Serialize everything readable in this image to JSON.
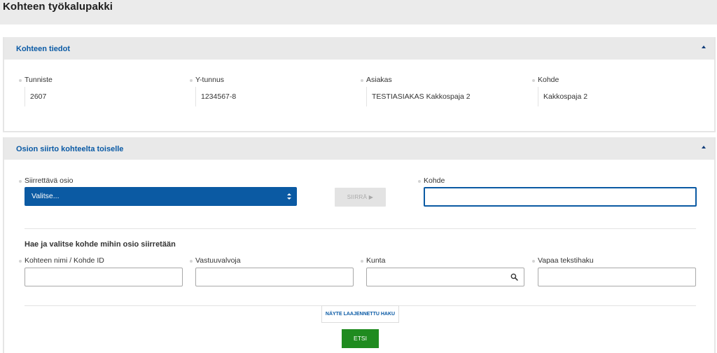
{
  "page": {
    "title": "Kohteen työkalupakki"
  },
  "details_panel": {
    "title": "Kohteen tiedot",
    "fields": [
      {
        "label": "Tunniste",
        "value": "2607"
      },
      {
        "label": "Y-tunnus",
        "value": "1234567-8"
      },
      {
        "label": "Asiakas",
        "value": "TESTIASIAKAS Kakkospaja 2"
      },
      {
        "label": "Kohde",
        "value": "Kakkospaja 2"
      }
    ]
  },
  "transfer_panel": {
    "title": "Osion siirto kohteelta toiselle",
    "osio_label": "Siirrettävä osio",
    "osio_selected": "Valitse...",
    "move_button": "SIIRRÄ ▶",
    "target_label": "Kohde",
    "target_value": "",
    "search_heading": "Hae ja valitse kohde mihin osio siirretään",
    "search_fields": {
      "name_label": "Kohteen nimi / Kohde ID",
      "supervisor_label": "Vastuuvalvoja",
      "municipality_label": "Kunta",
      "freetext_label": "Vapaa tekstihaku"
    },
    "advanced_button": "NÄYTE LAAJENNETTU HAKU",
    "search_button": "ETSI"
  },
  "colors": {
    "accent": "#0b5aa3",
    "primary_button": "#1f8b1f"
  }
}
